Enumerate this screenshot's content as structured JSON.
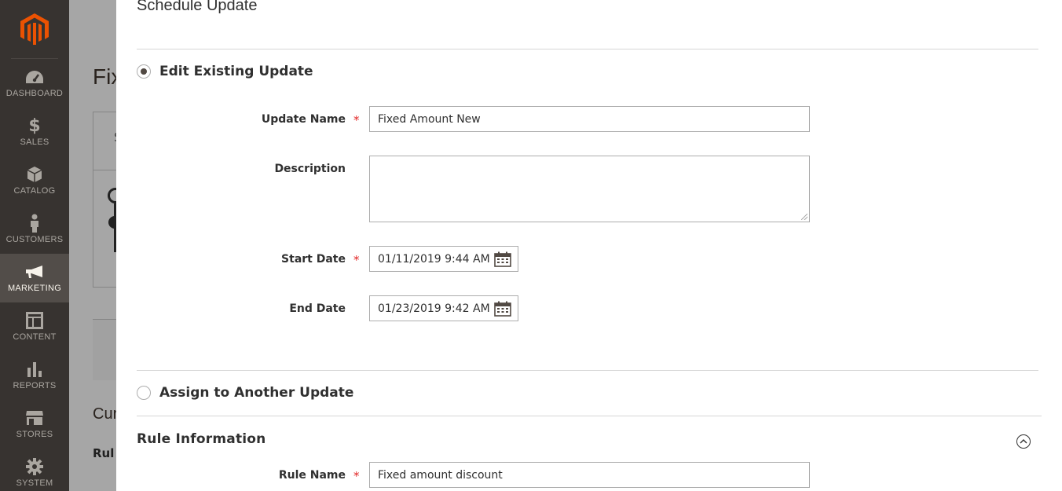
{
  "nav": {
    "items": [
      {
        "label": "DASHBOARD",
        "icon": "dashboard-icon"
      },
      {
        "label": "SALES",
        "icon": "dollar-icon"
      },
      {
        "label": "CATALOG",
        "icon": "box-icon"
      },
      {
        "label": "CUSTOMERS",
        "icon": "person-icon"
      },
      {
        "label": "MARKETING",
        "icon": "megaphone-icon",
        "active": true
      },
      {
        "label": "CONTENT",
        "icon": "layout-icon"
      },
      {
        "label": "REPORTS",
        "icon": "bar-chart-icon"
      },
      {
        "label": "STORES",
        "icon": "store-icon"
      },
      {
        "label": "SYSTEM",
        "icon": "gear-icon"
      }
    ]
  },
  "background": {
    "title": "Fix",
    "box_header": "S",
    "section_title": "Cur",
    "rule_label": "Rul"
  },
  "modal": {
    "title": "Schedule Update",
    "edit_existing_label": "Edit Existing Update",
    "assign_another_label": "Assign to Another Update",
    "fields": {
      "update_name_label": "Update Name",
      "update_name_value": "Fixed Amount New",
      "description_label": "Description",
      "description_value": "",
      "start_date_label": "Start Date",
      "start_date_value": "01/11/2019 9:44 AM",
      "end_date_label": "End Date",
      "end_date_value": "01/23/2019 9:42 AM"
    },
    "required_mark": "*",
    "rule_info": {
      "title": "Rule Information",
      "rule_name_label": "Rule Name",
      "rule_name_value": "Fixed amount discount"
    }
  },
  "colors": {
    "nav_bg": "#373330",
    "nav_active": "#524d49",
    "logo_orange": "#eb5202",
    "required": "#e22626"
  }
}
